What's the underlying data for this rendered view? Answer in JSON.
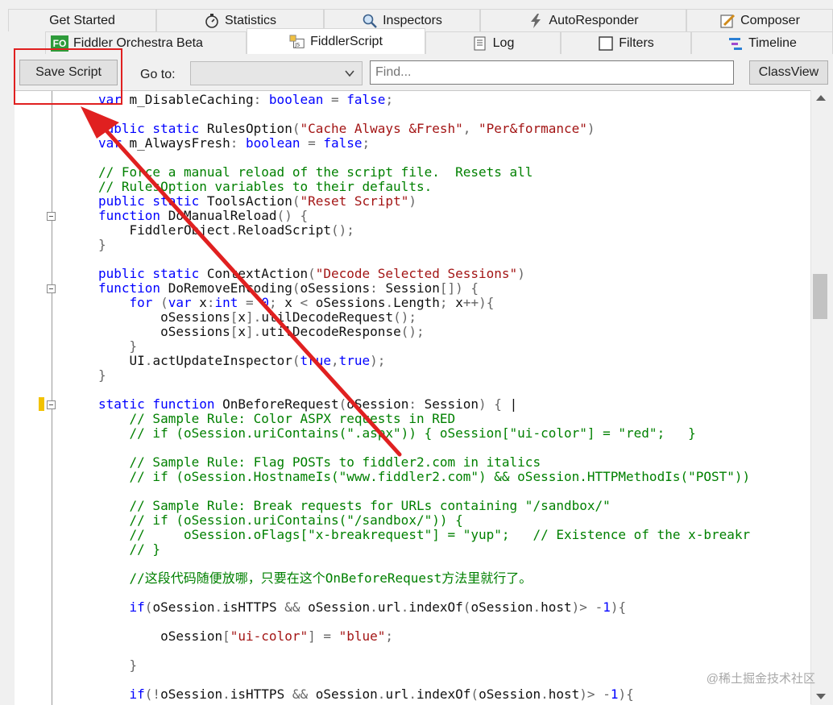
{
  "tabs_row1": [
    {
      "label": "Get Started",
      "icon": ""
    },
    {
      "label": "Statistics",
      "icon": "stopwatch-icon"
    },
    {
      "label": "Inspectors",
      "icon": "magnifier-icon"
    },
    {
      "label": "AutoResponder",
      "icon": "lightning-icon"
    },
    {
      "label": "Composer",
      "icon": "pencil-icon"
    }
  ],
  "tabs_row2": [
    {
      "label": "Fiddler Orchestra Beta",
      "icon": "fo-icon",
      "badge": "FO"
    },
    {
      "label": "FiddlerScript",
      "icon": "script-js-icon",
      "active": true
    },
    {
      "label": "Log",
      "icon": "log-icon"
    },
    {
      "label": "Filters",
      "icon": "checkbox-icon"
    },
    {
      "label": "Timeline",
      "icon": "timeline-icon"
    }
  ],
  "toolbar": {
    "save_label": "Save Script",
    "goto_label": "Go to:",
    "goto_value": "",
    "find_placeholder": "Find...",
    "classview_label": "ClassView"
  },
  "code_lines": [
    [
      [
        "kw",
        "var "
      ],
      [
        "pl",
        "m_DisableCaching"
      ],
      [
        "op",
        ": "
      ],
      [
        "kw",
        "boolean"
      ],
      [
        "op",
        " = "
      ],
      [
        "kw",
        "false"
      ],
      [
        "op",
        ";"
      ]
    ],
    [],
    [
      [
        "kw",
        "public static "
      ],
      [
        "pl",
        "RulesOption"
      ],
      [
        "op",
        "("
      ],
      [
        "str",
        "\"Cache Always &Fresh\""
      ],
      [
        "op",
        ", "
      ],
      [
        "str",
        "\"Per&formance\""
      ],
      [
        "op",
        ")"
      ]
    ],
    [
      [
        "kw",
        "var "
      ],
      [
        "pl",
        "m_AlwaysFresh"
      ],
      [
        "op",
        ": "
      ],
      [
        "kw",
        "boolean"
      ],
      [
        "op",
        " = "
      ],
      [
        "kw",
        "false"
      ],
      [
        "op",
        ";"
      ]
    ],
    [],
    [
      [
        "cm",
        "// Force a manual reload of the script file.  Resets all"
      ]
    ],
    [
      [
        "cm",
        "// RulesOption variables to their defaults."
      ]
    ],
    [
      [
        "kw",
        "public static "
      ],
      [
        "pl",
        "ToolsAction"
      ],
      [
        "op",
        "("
      ],
      [
        "str",
        "\"Reset Script\""
      ],
      [
        "op",
        ")"
      ]
    ],
    [
      [
        "kw",
        "function "
      ],
      [
        "pl",
        "DoManualReload"
      ],
      [
        "op",
        "() {"
      ]
    ],
    [
      [
        "pl",
        "    FiddlerObject"
      ],
      [
        "op",
        "."
      ],
      [
        "pl",
        "ReloadScript"
      ],
      [
        "op",
        "();"
      ]
    ],
    [
      [
        "op",
        "}"
      ]
    ],
    [],
    [
      [
        "kw",
        "public static "
      ],
      [
        "pl",
        "ContextAction"
      ],
      [
        "op",
        "("
      ],
      [
        "str",
        "\"Decode Selected Sessions\""
      ],
      [
        "op",
        ")"
      ]
    ],
    [
      [
        "kw",
        "function "
      ],
      [
        "pl",
        "DoRemoveEncoding"
      ],
      [
        "op",
        "("
      ],
      [
        "pl",
        "oSessions"
      ],
      [
        "op",
        ": "
      ],
      [
        "pl",
        "Session"
      ],
      [
        "op",
        "[]) {"
      ]
    ],
    [
      [
        "kw",
        "    for "
      ],
      [
        "op",
        "("
      ],
      [
        "kw",
        "var "
      ],
      [
        "pl",
        "x"
      ],
      [
        "op",
        ":"
      ],
      [
        "kw",
        "int"
      ],
      [
        "op",
        " = "
      ],
      [
        "kw",
        "0"
      ],
      [
        "op",
        "; "
      ],
      [
        "pl",
        "x"
      ],
      [
        "op",
        " < "
      ],
      [
        "pl",
        "oSessions"
      ],
      [
        "op",
        "."
      ],
      [
        "pl",
        "Length"
      ],
      [
        "op",
        "; "
      ],
      [
        "pl",
        "x"
      ],
      [
        "op",
        "++){"
      ]
    ],
    [
      [
        "pl",
        "        oSessions"
      ],
      [
        "op",
        "["
      ],
      [
        "pl",
        "x"
      ],
      [
        "op",
        "]."
      ],
      [
        "pl",
        "utilDecodeRequest"
      ],
      [
        "op",
        "();"
      ]
    ],
    [
      [
        "pl",
        "        oSessions"
      ],
      [
        "op",
        "["
      ],
      [
        "pl",
        "x"
      ],
      [
        "op",
        "]."
      ],
      [
        "pl",
        "utilDecodeResponse"
      ],
      [
        "op",
        "();"
      ]
    ],
    [
      [
        "op",
        "    }"
      ]
    ],
    [
      [
        "pl",
        "    UI"
      ],
      [
        "op",
        "."
      ],
      [
        "pl",
        "actUpdateInspector"
      ],
      [
        "op",
        "("
      ],
      [
        "kw",
        "true"
      ],
      [
        "op",
        ","
      ],
      [
        "kw",
        "true"
      ],
      [
        "op",
        ");"
      ]
    ],
    [
      [
        "op",
        "}"
      ]
    ],
    [],
    [
      [
        "kw",
        "static function "
      ],
      [
        "pl",
        "OnBeforeRequest"
      ],
      [
        "op",
        "("
      ],
      [
        "pl",
        "oSession"
      ],
      [
        "op",
        ": "
      ],
      [
        "pl",
        "Session"
      ],
      [
        "op",
        ") { "
      ],
      [
        "pl",
        "|"
      ]
    ],
    [
      [
        "cm",
        "    // Sample Rule: Color ASPX requests in RED"
      ]
    ],
    [
      [
        "cm",
        "    // if (oSession.uriContains(\".aspx\")) { oSession[\"ui-color\"] = \"red\";   }"
      ]
    ],
    [],
    [
      [
        "cm",
        "    // Sample Rule: Flag POSTs to fiddler2.com in italics"
      ]
    ],
    [
      [
        "cm",
        "    // if (oSession.HostnameIs(\"www.fiddler2.com\") && oSession.HTTPMethodIs(\"POST\"))"
      ]
    ],
    [],
    [
      [
        "cm",
        "    // Sample Rule: Break requests for URLs containing \"/sandbox/\""
      ]
    ],
    [
      [
        "cm",
        "    // if (oSession.uriContains(\"/sandbox/\")) {"
      ]
    ],
    [
      [
        "cm",
        "    //     oSession.oFlags[\"x-breakrequest\"] = \"yup\";   // Existence of the x-breakr"
      ]
    ],
    [
      [
        "cm",
        "    // }"
      ]
    ],
    [],
    [
      [
        "cm",
        "    //这段代码随便放哪，只要在这个OnBeforeRequest方法里就行了。"
      ]
    ],
    [],
    [
      [
        "kw",
        "    if"
      ],
      [
        "op",
        "("
      ],
      [
        "pl",
        "oSession"
      ],
      [
        "op",
        "."
      ],
      [
        "pl",
        "isHTTPS"
      ],
      [
        "op",
        " && "
      ],
      [
        "pl",
        "oSession"
      ],
      [
        "op",
        "."
      ],
      [
        "pl",
        "url"
      ],
      [
        "op",
        "."
      ],
      [
        "pl",
        "indexOf"
      ],
      [
        "op",
        "("
      ],
      [
        "pl",
        "oSession"
      ],
      [
        "op",
        "."
      ],
      [
        "pl",
        "host"
      ],
      [
        "op",
        ")> -"
      ],
      [
        "kw",
        "1"
      ],
      [
        "op",
        "){"
      ]
    ],
    [],
    [
      [
        "pl",
        "        oSession"
      ],
      [
        "op",
        "["
      ],
      [
        "str",
        "\"ui-color\""
      ],
      [
        "op",
        "] = "
      ],
      [
        "str",
        "\"blue\""
      ],
      [
        "op",
        ";"
      ]
    ],
    [],
    [
      [
        "op",
        "    }"
      ]
    ],
    [],
    [
      [
        "kw",
        "    if"
      ],
      [
        "op",
        "(!"
      ],
      [
        "pl",
        "oSession"
      ],
      [
        "op",
        "."
      ],
      [
        "pl",
        "isHTTPS"
      ],
      [
        "op",
        " && "
      ],
      [
        "pl",
        "oSession"
      ],
      [
        "op",
        "."
      ],
      [
        "pl",
        "url"
      ],
      [
        "op",
        "."
      ],
      [
        "pl",
        "indexOf"
      ],
      [
        "op",
        "("
      ],
      [
        "pl",
        "oSession"
      ],
      [
        "op",
        "."
      ],
      [
        "pl",
        "host"
      ],
      [
        "op",
        ")> -"
      ],
      [
        "kw",
        "1"
      ],
      [
        "op",
        "){"
      ]
    ]
  ],
  "watermark": "@稀土掘金技术社区",
  "colors": {
    "keyword": "#0000ff",
    "string": "#a31515",
    "comment": "#008000",
    "annotation": "#e02020"
  }
}
